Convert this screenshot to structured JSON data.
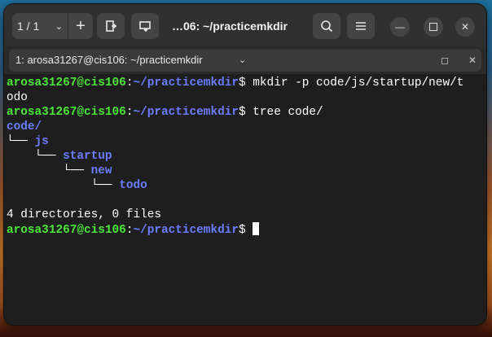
{
  "headerbar": {
    "tab_count": "1 / 1",
    "title": "…06: ~/practicemkdir",
    "icons": [
      "chevron-down-icon",
      "plus-icon",
      "open-tab-icon",
      "send-icon",
      "search-icon",
      "menu-icon",
      "minimize-icon",
      "maximize-icon",
      "close-icon"
    ]
  },
  "tab": {
    "label": "1: arosa31267@cis106: ~/practicemkdir"
  },
  "terminal": {
    "prompt_user": "arosa31267@cis106",
    "prompt_sep": ":",
    "prompt_path": "~/practicemkdir",
    "prompt_end": "$ ",
    "cmd1_a": "mkdir -p code/js/startup/new/t",
    "cmd1_b": "odo",
    "cmd2": "tree code/",
    "tree_root": "code/",
    "tree_js_prefix": "└── ",
    "tree_js": "js",
    "tree_startup_prefix": "    └── ",
    "tree_startup": "startup",
    "tree_new_prefix": "        └── ",
    "tree_new": "new",
    "tree_todo_prefix": "            └── ",
    "tree_todo": "todo",
    "summary": "4 directories, 0 files"
  },
  "colors": {
    "user": "#4ce63a",
    "path": "#6a7dff",
    "background": "#1e1e1e"
  }
}
